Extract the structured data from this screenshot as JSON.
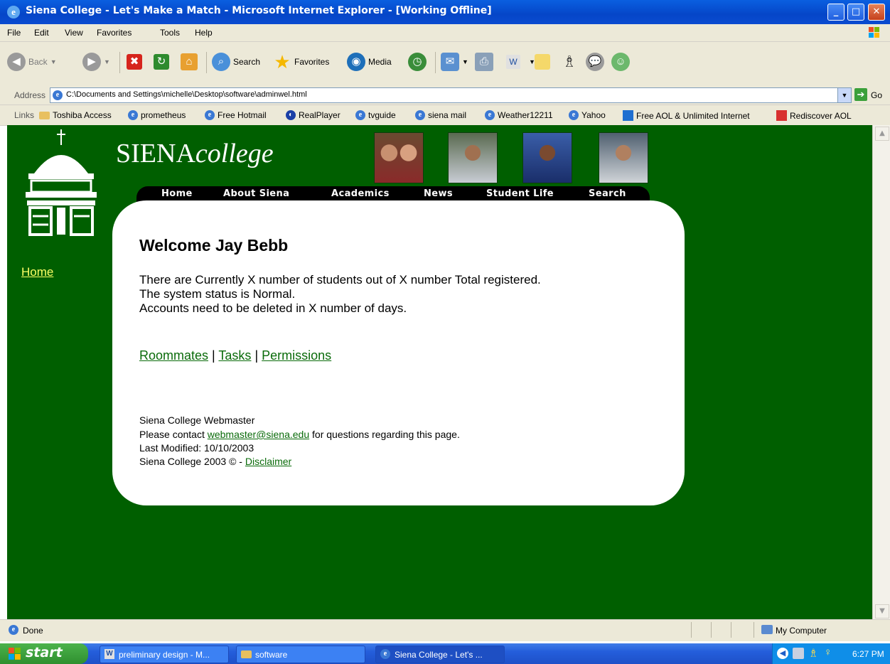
{
  "window": {
    "title": "Siena College - Let's Make a Match - Microsoft Internet Explorer - [Working Offline]"
  },
  "menu": [
    "File",
    "Edit",
    "View",
    "Favorites",
    "Tools",
    "Help"
  ],
  "toolbar": {
    "back": "Back",
    "search": "Search",
    "favorites": "Favorites",
    "media": "Media"
  },
  "address": {
    "label": "Address",
    "value": "C:\\Documents and Settings\\michelle\\Desktop\\software\\adminwel.html",
    "go": "Go"
  },
  "links": {
    "label": "Links",
    "items": [
      "Toshiba Access",
      "prometheus",
      "Free Hotmail",
      "RealPlayer",
      "tvguide",
      "siena mail",
      "Weather12211",
      "Yahoo",
      "Free AOL & Unlimited Internet",
      "Rediscover AOL"
    ]
  },
  "site": {
    "logo_main": "SIENA",
    "logo_sub": "college",
    "nav": [
      "Home",
      "About Siena",
      "Academics",
      "News",
      "Student Life",
      "Search"
    ],
    "sidebar_home": "Home"
  },
  "content": {
    "welcome": "Welcome Jay Bebb",
    "line1": "There are Currently X number of students out of X number Total registered.",
    "line2": "The system status is Normal.",
    "line3": "Accounts need to be deleted in X number of days.",
    "link_roommates": "Roommates",
    "link_tasks": "Tasks",
    "link_permissions": "Permissions",
    "sep": "|"
  },
  "footer": {
    "webmaster": "Siena College Webmaster",
    "contact_pre": "Please contact ",
    "contact_email": "webmaster@siena.edu",
    "contact_post": " for questions regarding this page.",
    "modified": "Last Modified: 10/10/2003",
    "copyright": "Siena College 2003 © - ",
    "disclaimer": "Disclaimer"
  },
  "status": {
    "text": "Done",
    "zone": "My Computer"
  },
  "taskbar": {
    "start": "start",
    "tasks": [
      "preliminary design - M...",
      "software",
      "Siena College - Let's ..."
    ],
    "clock": "6:27 PM"
  },
  "colors": {
    "page_bg": "#005f00",
    "link": "#0a6b0a",
    "sidebar_link": "#ffff66"
  }
}
